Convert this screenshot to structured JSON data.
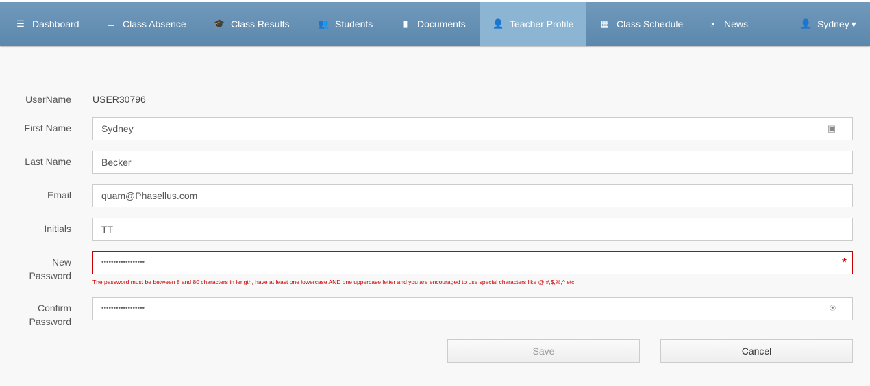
{
  "nav": {
    "items": [
      {
        "label": "Dashboard",
        "icon": "dashboard-icon",
        "glyph": "☰"
      },
      {
        "label": "Class Absence",
        "icon": "calendar-icon",
        "glyph": "▭"
      },
      {
        "label": "Class Results",
        "icon": "graduation-cap-icon",
        "glyph": "🎓"
      },
      {
        "label": "Students",
        "icon": "users-icon",
        "glyph": "👥"
      },
      {
        "label": "Documents",
        "icon": "file-icon",
        "glyph": "▮"
      },
      {
        "label": "Teacher Profile",
        "icon": "user-icon",
        "glyph": "👤"
      },
      {
        "label": "Class Schedule",
        "icon": "calendar-grid-icon",
        "glyph": "▦"
      },
      {
        "label": "News",
        "icon": "rss-icon",
        "glyph": "◔"
      }
    ],
    "active": "Teacher Profile",
    "user": {
      "label": "Sydney",
      "caret": "▾"
    }
  },
  "form": {
    "username": {
      "label": "UserName",
      "value": "USER30796"
    },
    "first_name": {
      "label": "First Name",
      "value": "Sydney"
    },
    "last_name": {
      "label": "Last Name",
      "value": "Becker"
    },
    "email": {
      "label": "Email",
      "value": "quam@Phasellus.com"
    },
    "initials": {
      "label": "Initials",
      "value": "TT"
    },
    "new_password": {
      "label_1": "New",
      "label_2": "Password",
      "value": "••••••••••••••••••",
      "required_mark": "*",
      "error": "The password must be between 8 and 80 characters in length, have at least one lowercase AND one uppercase letter and you are encouraged to use special characters like @,#,$,%,^ etc."
    },
    "confirm_password": {
      "label_1": "Confirm",
      "label_2": "Password",
      "value": "••••••••••••••••••"
    }
  },
  "buttons": {
    "save": "Save",
    "cancel": "Cancel"
  },
  "colors": {
    "nav": "#6691b5",
    "active": "#8cb4d3",
    "error": "#cc0000"
  }
}
